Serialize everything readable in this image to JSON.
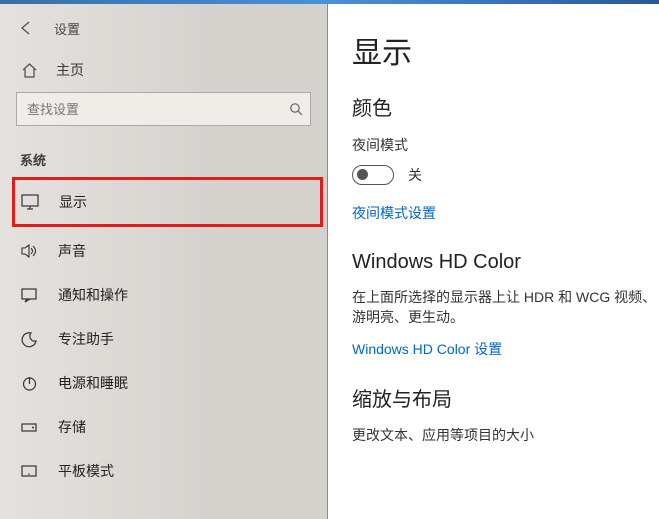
{
  "app_title": "设置",
  "home_label": "主页",
  "search_placeholder": "查找设置",
  "section_header": "系统",
  "nav": {
    "display": "显示",
    "sound": "声音",
    "notifications": "通知和操作",
    "focus_assist": "专注助手",
    "power": "电源和睡眠",
    "storage": "存储",
    "tablet": "平板模式"
  },
  "page_title": "显示",
  "color_section": "颜色",
  "night_light_label": "夜间模式",
  "toggle_state": "关",
  "night_light_settings": "夜间模式设置",
  "hd_color_title": "Windows HD Color",
  "hd_color_desc": "在上面所选择的显示器上让 HDR 和 WCG 视频、游明亮、更生动。",
  "hd_color_link": "Windows HD Color 设置",
  "scale_title": "缩放与布局",
  "scale_desc": "更改文本、应用等项目的大小"
}
